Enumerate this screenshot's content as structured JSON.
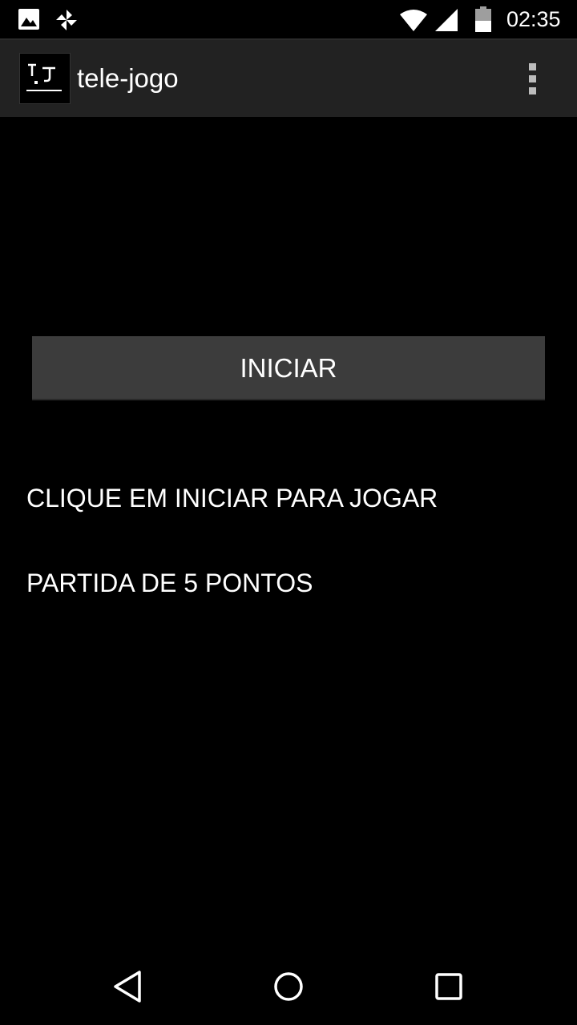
{
  "status_bar": {
    "time": "02:35",
    "icons": [
      "gallery-icon",
      "pinwheel-icon",
      "wifi-icon",
      "signal-icon",
      "battery-icon"
    ]
  },
  "action_bar": {
    "title": "tele-jogo",
    "app_icon": "tele-jogo-logo-icon",
    "menu_icon": "overflow-menu-icon"
  },
  "main": {
    "start_button_label": "INICIAR",
    "info_line_1": "CLIQUE EM INICIAR PARA JOGAR",
    "info_line_2": "PARTIDA DE 5 PONTOS"
  },
  "nav_bar": {
    "icons": [
      "back-icon",
      "home-icon",
      "recents-icon"
    ]
  },
  "colors": {
    "background": "#000000",
    "action_bar": "#222222",
    "button": "#3c3c3c",
    "text": "#ffffff"
  }
}
